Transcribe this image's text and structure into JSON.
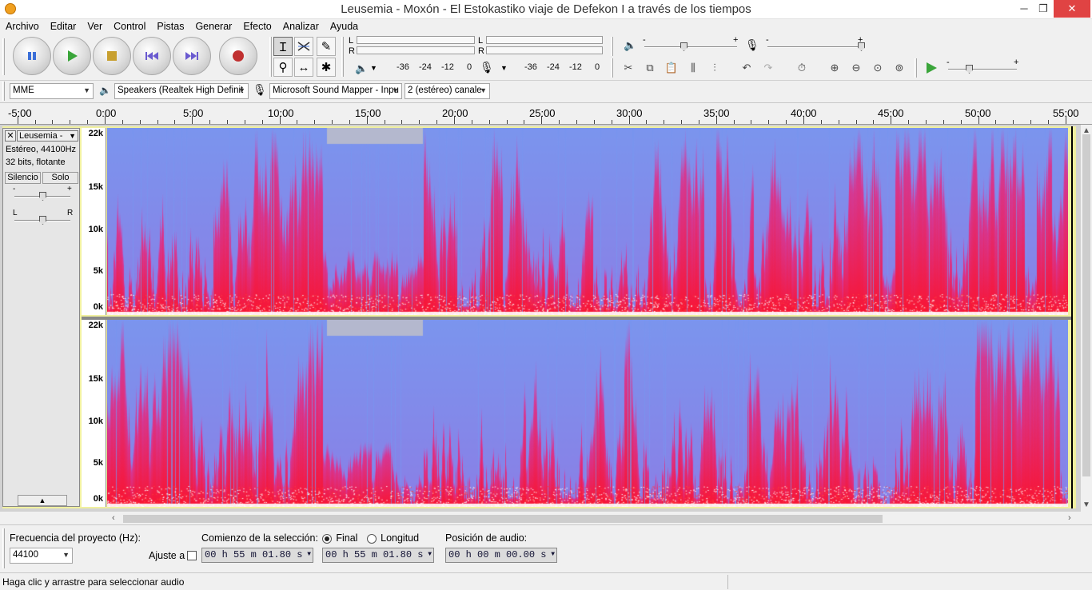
{
  "window": {
    "title": "Leusemia - Moxón - El Estokastiko viaje de Defekon I a través de los tiempos",
    "min_glyph": "─",
    "max_glyph": "❐",
    "close_glyph": "✕"
  },
  "menu": [
    "Archivo",
    "Editar",
    "Ver",
    "Control",
    "Pistas",
    "Generar",
    "Efecto",
    "Analizar",
    "Ayuda"
  ],
  "meters": {
    "play_channels": [
      "L",
      "R"
    ],
    "rec_channels": [
      "L",
      "R"
    ],
    "play_scale": [
      "-36",
      "-24",
      "-12",
      "0"
    ],
    "rec_scale": [
      "-36",
      "-24",
      "-12",
      "0"
    ]
  },
  "mixer": {
    "minus": "-",
    "plus": "+",
    "speed_minus": "-",
    "speed_plus": "+"
  },
  "device": {
    "host": "MME",
    "output": "Speakers (Realtek High Definit",
    "input": "Microsoft Sound Mapper - Inpu",
    "channels": "2 (estéreo) canale"
  },
  "ruler": [
    "-5:00",
    "0:00",
    "5:00",
    "10:00",
    "15:00",
    "20:00",
    "25:00",
    "30:00",
    "35:00",
    "40:00",
    "45:00",
    "50:00",
    "55:00"
  ],
  "track": {
    "name": "Leusemia -",
    "info1": "Estéreo, 44100Hz",
    "info2": "32 bits, flotante",
    "mute": "Silencio",
    "solo": "Solo",
    "gain_minus": "-",
    "gain_plus": "+",
    "pan_left": "L",
    "pan_right": "R",
    "freq_labels": [
      "22k",
      "15k",
      "10k",
      "5k",
      "0k"
    ],
    "freq_values_hz": [
      22050,
      15000,
      10000,
      5000,
      0
    ]
  },
  "selection_bar": {
    "rate_label": "Frecuencia del proyecto (Hz):",
    "rate_value": "44100",
    "snap_label": "Ajuste a",
    "start_label": "Comienzo de la selección:",
    "end_option": "Final",
    "length_option": "Longitud",
    "start_time": "00 h 55 m 01.80 s",
    "end_time": "00 h 55 m 01.80 s",
    "pos_label": "Posición de audio:",
    "pos_time": "00 h 00 m 00.00 s"
  },
  "status": "Haga clic y arrastre para seleccionar audio",
  "colors": {
    "accent_red": "#c03030",
    "play_green": "#3aa53a",
    "pause_blue": "#3b6fd8",
    "track_border": "#f0f0a0",
    "spec_blue": "#6d8df0",
    "spec_red": "#ff1a40"
  }
}
